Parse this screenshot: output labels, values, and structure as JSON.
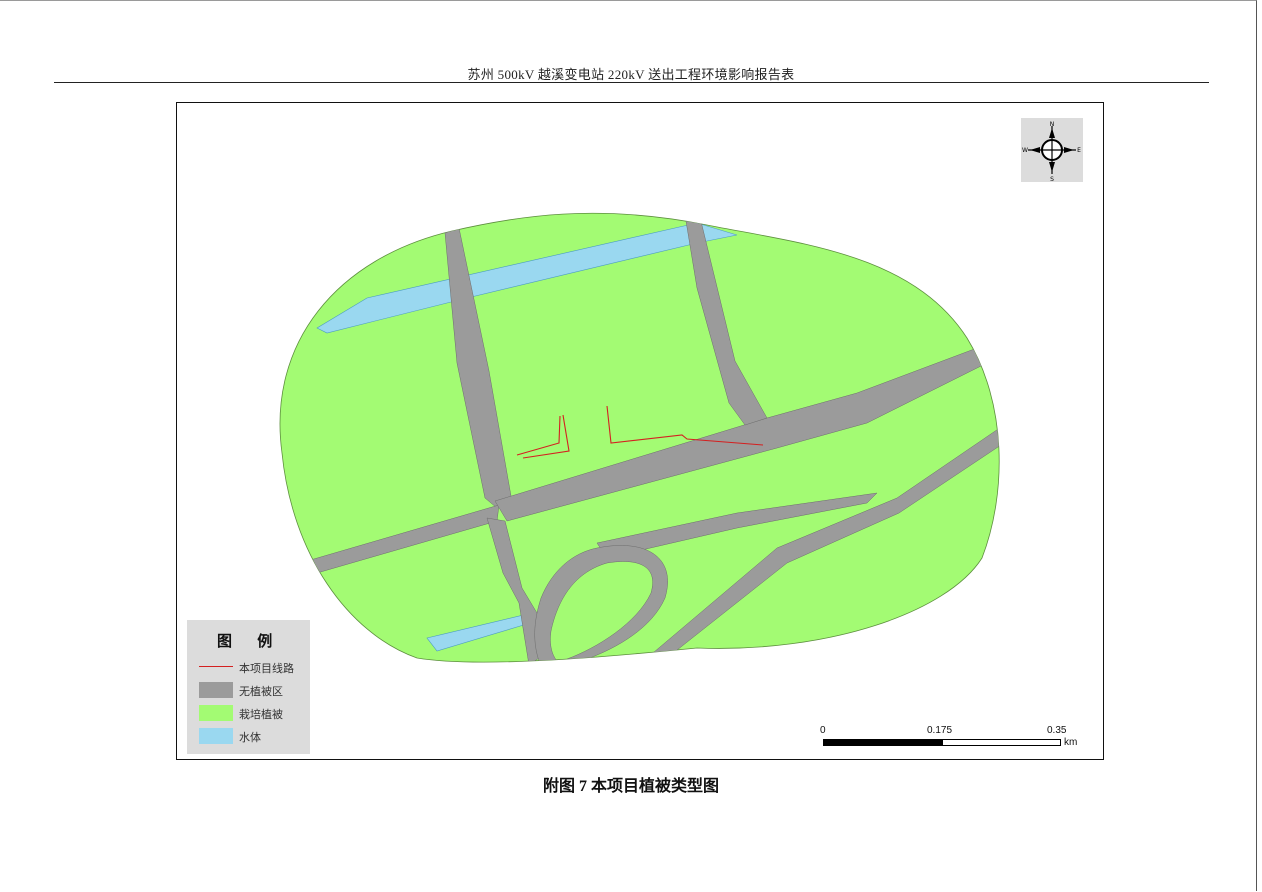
{
  "document": {
    "header_title": "苏州 500kV 越溪变电站 220kV 送出工程环境影响报告表",
    "caption": "附图 7  本项目植被类型图"
  },
  "compass": {
    "north": "N",
    "south": "S",
    "east": "E",
    "west": "W"
  },
  "legend": {
    "title": "图 例",
    "items": [
      {
        "label": "本项目线路",
        "kind": "line",
        "color": "#d42020"
      },
      {
        "label": "无植被区",
        "kind": "fill",
        "color": "#9b9b9b"
      },
      {
        "label": "栽培植被",
        "kind": "fill",
        "color": "#a3fb73"
      },
      {
        "label": "水体",
        "kind": "fill",
        "color": "#9ad8f0"
      }
    ]
  },
  "scale": {
    "ticks": [
      "0",
      "0.175",
      "0.35"
    ],
    "unit": "km"
  },
  "colors": {
    "vegetation": "#a3fb73",
    "no_vegetation": "#9b9b9b",
    "water": "#9ad8f0",
    "route": "#d42020"
  }
}
